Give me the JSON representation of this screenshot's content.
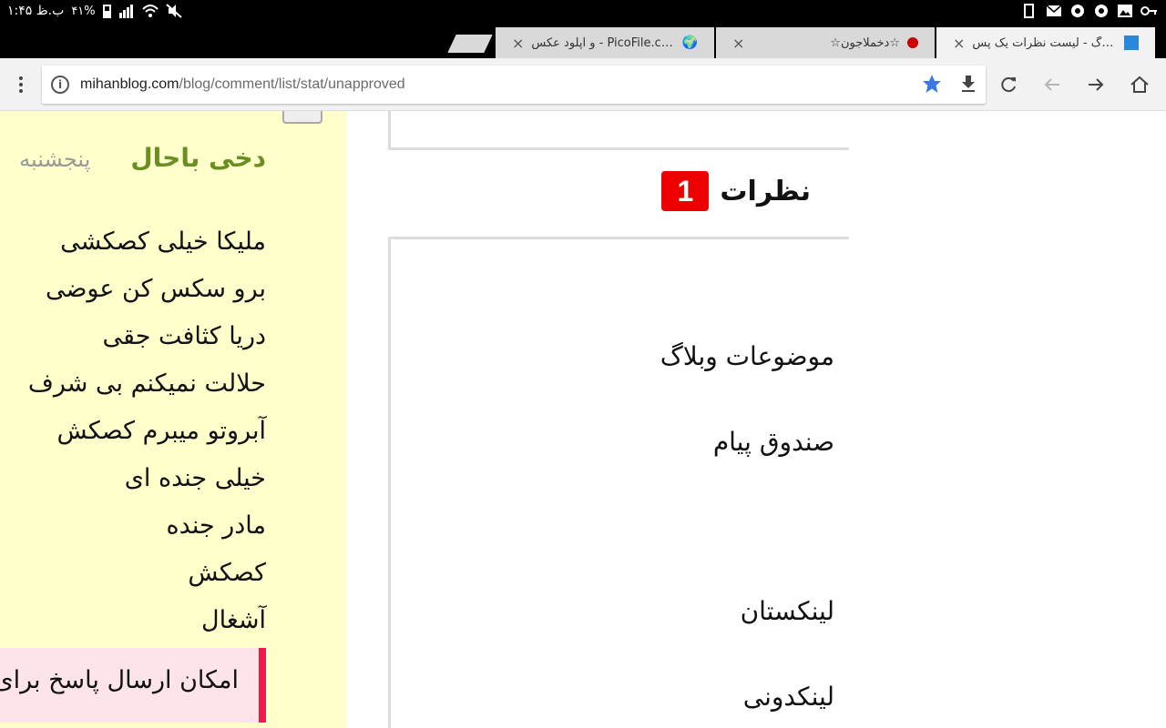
{
  "status_bar": {
    "time": "۱:۴۵ ب.ظ",
    "battery": "۴۱%"
  },
  "tabs": [
    {
      "title": "میهن بلاگ - لیست نظرات یک پس",
      "active": true
    },
    {
      "title": "☆دخملاجون☆",
      "active": false
    },
    {
      "title": "و آپلود عکس - PicoFile.com",
      "active": false
    }
  ],
  "toolbar": {
    "url_host": "mihanblog.com",
    "url_path": "/blog/comment/list/stat/unapproved"
  },
  "sidebar": {
    "name": "دخی باحال",
    "day": "پنجشنبه",
    "lines": [
      "ملیکا خیلی کصکشی",
      "برو سکس کن عوضی",
      "دریا کثافت جقی",
      "حلالت نمیکنم بی شرف",
      "آبروتو میبرم کصکش",
      "خیلی جنده ای",
      "مادر جنده",
      "کصکش",
      "آشغال"
    ],
    "notice": "امکان ارسال پاسخ برای"
  },
  "main": {
    "comments_title": "نظرات",
    "comments_count": "1",
    "links": [
      "موضوعات وبلاگ",
      "صندوق پیام",
      "لینکستان",
      "لینکدونی"
    ]
  }
}
